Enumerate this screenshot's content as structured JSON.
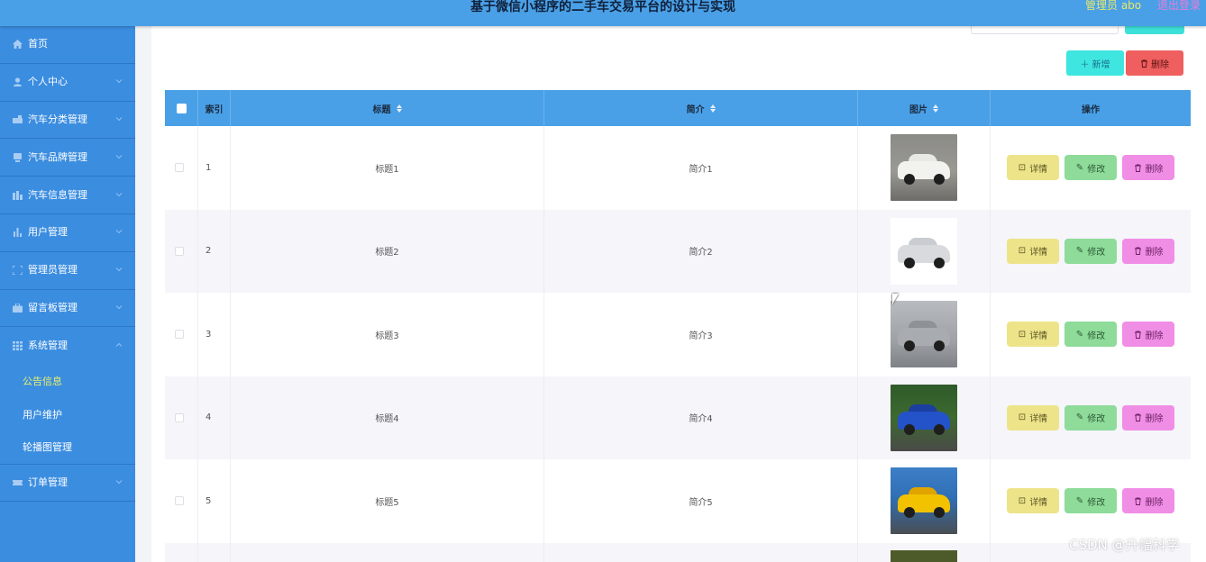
{
  "header": {
    "title": "基于微信小程序的二手车交易平台的设计与实现",
    "admin_label": "管理员 abo",
    "logout_label": "退出登录"
  },
  "sidebar": {
    "items": [
      {
        "label": "首页",
        "icon": "home-icon"
      },
      {
        "label": "个人中心",
        "icon": "user-icon"
      },
      {
        "label": "汽车分类管理",
        "icon": "car-category-icon"
      },
      {
        "label": "汽车品牌管理",
        "icon": "brand-icon"
      },
      {
        "label": "汽车信息管理",
        "icon": "info-icon"
      },
      {
        "label": "用户管理",
        "icon": "chart-icon"
      },
      {
        "label": "管理员管理",
        "icon": "frame-icon"
      },
      {
        "label": "留言板管理",
        "icon": "briefcase-icon"
      },
      {
        "label": "系统管理",
        "icon": "grid-icon"
      }
    ],
    "system_sub": [
      {
        "label": "公告信息"
      },
      {
        "label": "用户维护"
      },
      {
        "label": "轮播图管理"
      }
    ],
    "last_item": {
      "label": "订单管理",
      "icon": "ticket-icon"
    }
  },
  "toolbar": {
    "add_label": "新增",
    "delete_label": "删除"
  },
  "table": {
    "headers": {
      "index": "索引",
      "title": "标题",
      "intro": "简介",
      "image": "图片",
      "action": "操作"
    },
    "rows": [
      {
        "index": "1",
        "title": "标题1",
        "intro": "简介1"
      },
      {
        "index": "2",
        "title": "标题2",
        "intro": "简介2"
      },
      {
        "index": "3",
        "title": "标题3",
        "intro": "简介3"
      },
      {
        "index": "4",
        "title": "标题4",
        "intro": "简介4"
      },
      {
        "index": "5",
        "title": "标题5",
        "intro": "简介5"
      }
    ],
    "actions": {
      "detail": "详情",
      "edit": "修改",
      "delete": "删除"
    }
  },
  "watermark": "CSDN @升幅科学",
  "colors": {
    "topbar": "#4aa0e6",
    "sidebar": "#3b8de0",
    "active_sub": "#e8f06a"
  }
}
